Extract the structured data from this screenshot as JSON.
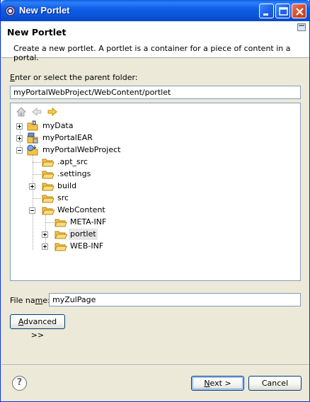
{
  "window": {
    "title": "New Portlet"
  },
  "header": {
    "title": "New Portlet",
    "description": "Create a new portlet. A portlet is a container for a piece of content in a portal."
  },
  "parent_folder": {
    "label_prefix": "E",
    "label_rest": "nter or select the parent folder:",
    "value": "myPortalWebProject/WebContent/portlet"
  },
  "tree": {
    "toolbar": [
      "home-icon",
      "back-arrow-icon",
      "forward-arrow-icon"
    ],
    "items": [
      {
        "label": "myData",
        "icon": "project-icon"
      },
      {
        "label": "myPortalEAR",
        "icon": "ear-project-icon"
      },
      {
        "label": "myPortalWebProject",
        "icon": "web-project-icon"
      },
      {
        "label": ".apt_src",
        "icon": "folder-icon"
      },
      {
        "label": ".settings",
        "icon": "folder-icon"
      },
      {
        "label": "build",
        "icon": "folder-icon"
      },
      {
        "label": "src",
        "icon": "folder-icon"
      },
      {
        "label": "WebContent",
        "icon": "open-folder-icon"
      },
      {
        "label": "META-INF",
        "icon": "folder-icon"
      },
      {
        "label": "portlet",
        "icon": "open-folder-icon",
        "selected": true
      },
      {
        "label": "WEB-INF",
        "icon": "folder-icon"
      }
    ]
  },
  "file_name": {
    "label_a": "File na",
    "label_u": "m",
    "label_b": "e:",
    "value": "myZulPage"
  },
  "buttons": {
    "advanced_u": "A",
    "advanced_rest": "dvanced >>",
    "next_u": "N",
    "next_rest": "ext >",
    "cancel": "Cancel"
  },
  "colors": {
    "titlebar": "#0b54d9",
    "folder": "#f5c348",
    "window_bg": "#ece9d8"
  }
}
